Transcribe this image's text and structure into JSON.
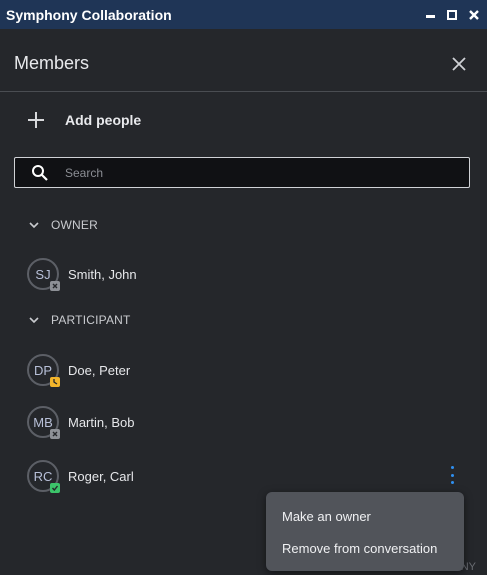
{
  "window": {
    "title": "Symphony Collaboration"
  },
  "panel": {
    "title": "Members"
  },
  "actions": {
    "add_people": "Add people"
  },
  "search": {
    "placeholder": "Search"
  },
  "sections": {
    "owner": "OWNER",
    "participant": "PARTICIPANT"
  },
  "members": [
    {
      "initials": "SJ",
      "name": "Smith, John",
      "status": "offline"
    },
    {
      "initials": "DP",
      "name": "Doe, Peter",
      "status": "away"
    },
    {
      "initials": "MB",
      "name": "Martin, Bob",
      "status": "offline"
    },
    {
      "initials": "RC",
      "name": "Roger, Carl",
      "status": "available"
    }
  ],
  "context_menu": {
    "items": [
      "Make an owner",
      "Remove from conversation"
    ]
  },
  "footer": {
    "partial_text": "NY"
  },
  "colors": {
    "titlebar": "#1f3556",
    "background": "#25272b",
    "accent": "#2f8ff0",
    "status_available": "#3cc46a",
    "status_away": "#f3b52b",
    "status_offline": "#8d9096"
  }
}
